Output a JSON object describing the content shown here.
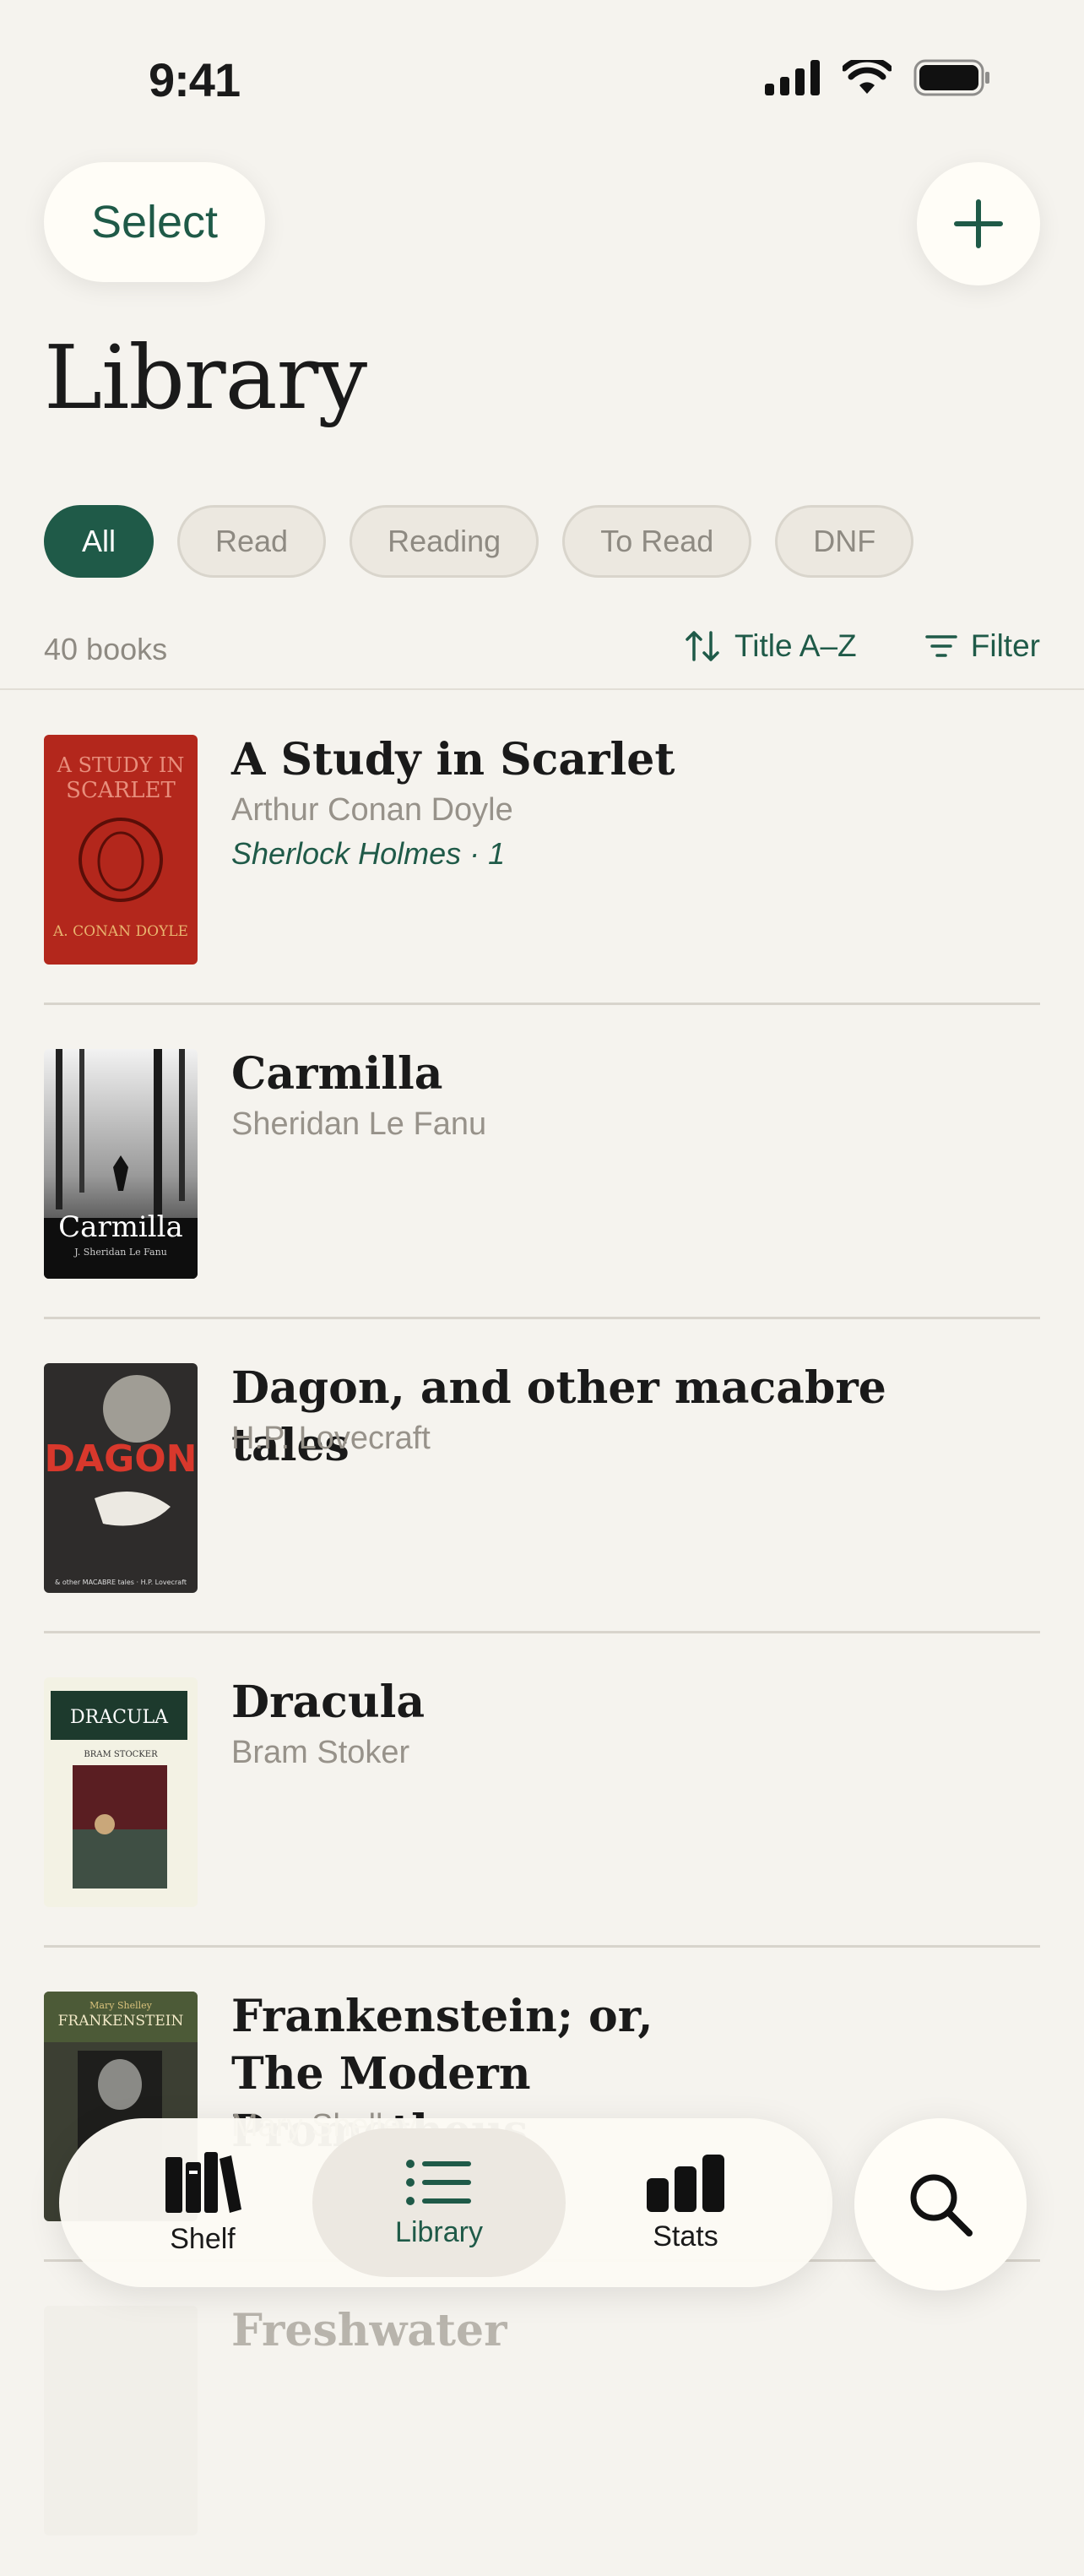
{
  "status": {
    "time": "9:41"
  },
  "header": {
    "select_label": "Select",
    "title": "Library"
  },
  "filters": [
    "All",
    "Read",
    "Reading",
    "To Read",
    "DNF"
  ],
  "toolbar": {
    "count": "40 books",
    "sort_label": "Title A–Z",
    "filter_label": "Filter"
  },
  "books": [
    {
      "title": "A Study in Scarlet",
      "author": "Arthur Conan Doyle",
      "series": "Sherlock Holmes · 1",
      "cover": {
        "text1": "A STUDY IN",
        "text2": "SCARLET",
        "text3": "A. CONAN DOYLE",
        "bg": "#B3271C"
      }
    },
    {
      "title": "Carmilla",
      "author": "Sheridan Le Fanu",
      "series": "",
      "cover": {
        "text1": "Carmilla",
        "text2": "J. Sheridan Le Fanu",
        "bg": "#0E0E0E"
      }
    },
    {
      "title": "Dagon, and other macabre tales",
      "author": "H.P. Lovecraft",
      "series": "",
      "cover": {
        "text1": "DAGON",
        "text2": "& other MACABRE tales · H.P. Lovecraft",
        "bg": "#2E2C2B"
      }
    },
    {
      "title": "Dracula",
      "author": "Bram Stoker",
      "series": "",
      "cover": {
        "text1": "DRACULA",
        "text2": "BRAM STOCKER",
        "bg": "#F3F2E4"
      }
    },
    {
      "title": "Frankenstein; or, The Modern Prometheus",
      "author": "Mary Shelley",
      "series": "",
      "cover": {
        "text1": "Mary Shelley",
        "text2": "FRANKENSTEIN",
        "bg": "#3C3F33"
      }
    },
    {
      "title": "Freshwater",
      "author": "",
      "series": "",
      "cover": {
        "bg": "#F1EFE9"
      }
    }
  ],
  "tabs": [
    {
      "label": "Shelf"
    },
    {
      "label": "Library"
    },
    {
      "label": "Stats"
    }
  ],
  "colors": {
    "accent": "#1F5A48",
    "background": "#F5F3EE"
  }
}
